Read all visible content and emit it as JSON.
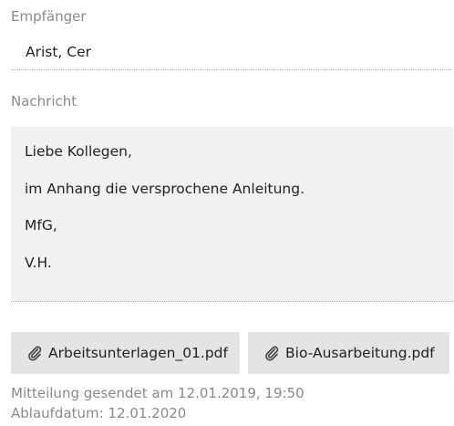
{
  "recipient": {
    "label": "Empfänger",
    "value": "Arist, Cer"
  },
  "message": {
    "label": "Nachricht",
    "lines": [
      "Liebe Kollegen,",
      "im Anhang die versprochene Anleitung.",
      "MfG,",
      "V.H."
    ]
  },
  "attachments": [
    {
      "icon": "paperclip-icon",
      "name": "Arbeitsunterlagen_01.pdf"
    },
    {
      "icon": "paperclip-icon",
      "name": "Bio-Ausarbeitung.pdf"
    }
  ],
  "footer": {
    "sent": "Mitteilung gesendet am 12.01.2019, 19:50",
    "expiry": "Ablaufdatum: 12.01.2020"
  },
  "colors": {
    "label_gray": "#8a8a8a",
    "message_background": "#f1f1f1",
    "attachment_background": "#e4e4e4",
    "text": "#222222"
  }
}
